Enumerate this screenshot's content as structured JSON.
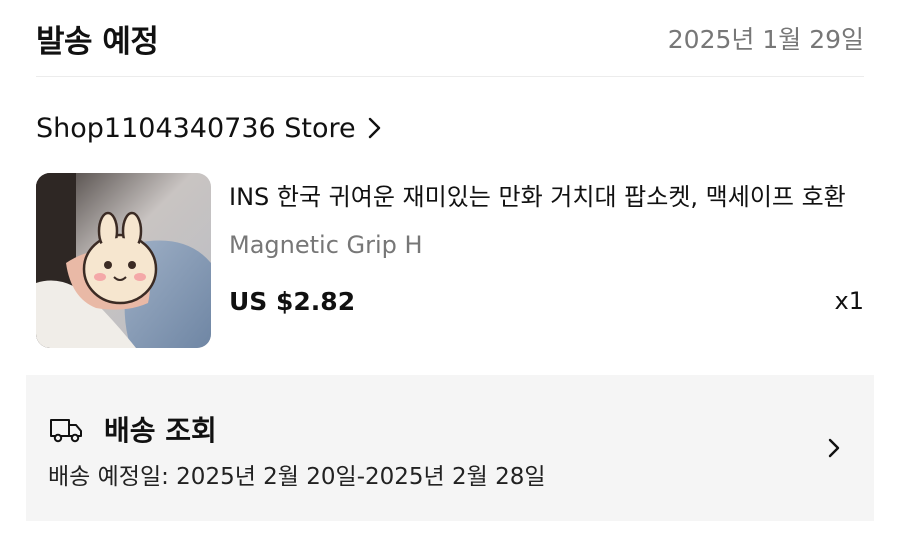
{
  "header": {
    "title": "발송 예정",
    "date": "2025년 1월 29일"
  },
  "store": {
    "name": "Shop1104340736 Store",
    "chevron_icon": "chevron-right-icon"
  },
  "product": {
    "title": "INS 한국 귀여운 재미있는 만화 거치대 팝소켓, 맥세이프 호환",
    "variant": "Magnetic Grip H",
    "price": "US $2.82",
    "quantity": "x1"
  },
  "tracking": {
    "icon": "truck-icon",
    "title": "배송 조회",
    "estimate": "배송 예정일: 2025년 2월 20일-2025년 2월 28일",
    "chevron_icon": "chevron-right-icon",
    "background_color": "#f5f5f5"
  }
}
